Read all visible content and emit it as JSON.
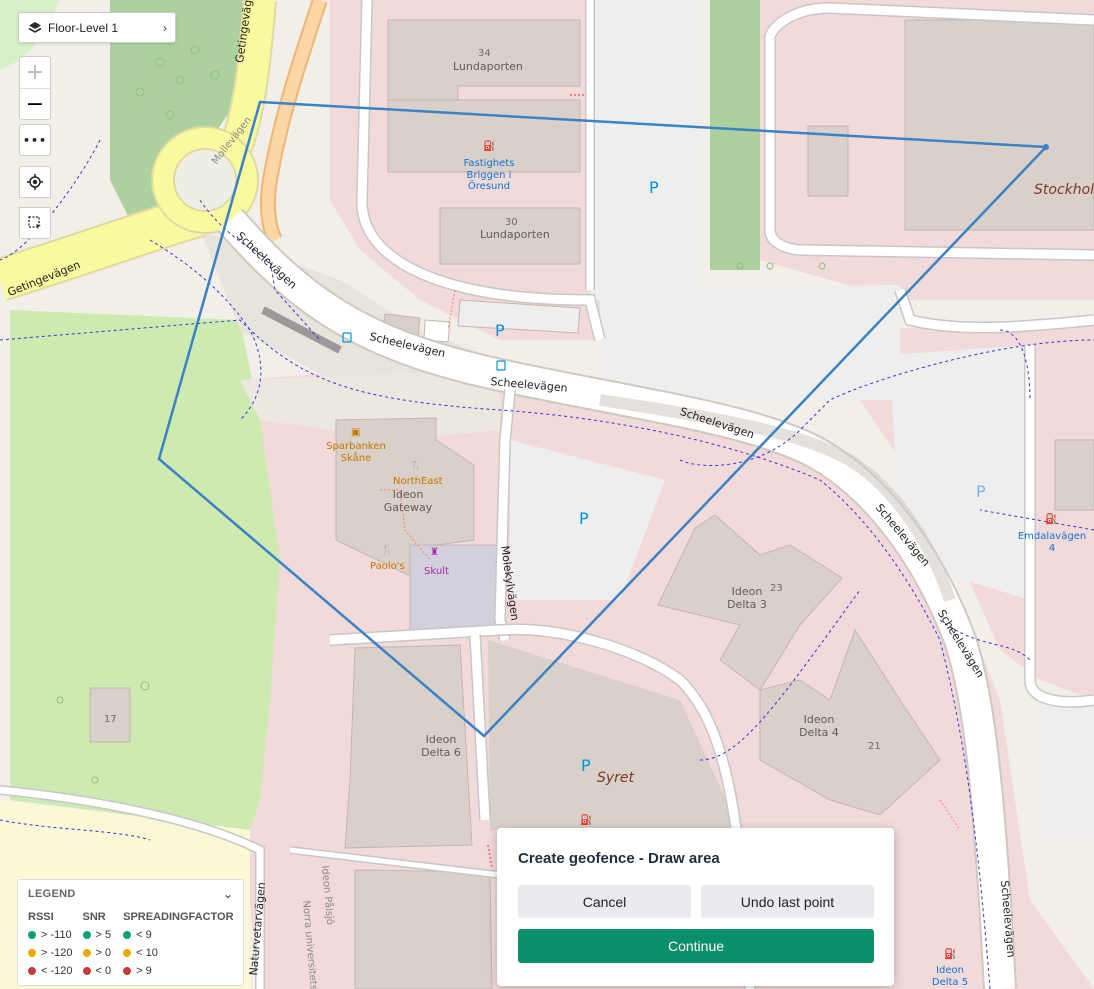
{
  "floor_selector": {
    "label": "Floor-Level 1",
    "icon": "layers-icon"
  },
  "map_controls": {
    "zoom_in": "+",
    "zoom_out": "−",
    "more": "•••",
    "locate_icon": "crosshair-icon",
    "select_icon": "area-select-icon"
  },
  "map": {
    "roads": [
      "Getingevägen",
      "Getingevägen",
      "Mollevägen",
      "Scheelevägen",
      "Scheelevägen",
      "Scheelevägen",
      "Scheelevägen",
      "Scheelevägen",
      "Scheelevägen",
      "Scheelevägen",
      "Molekylvägen",
      "Naturvetarvägen",
      "Ideon Pålsjö",
      "Norra universitetsområdet",
      "Scheelevägen"
    ],
    "buildings": [
      {
        "number": "34",
        "name": "Lundaporten"
      },
      {
        "number": "30",
        "name": "Lundaporten"
      },
      {
        "number": "23",
        "name": "Ideon Delta 3"
      },
      {
        "number": "21",
        "name": "Ideon Delta 4"
      },
      {
        "number": "",
        "name": "Ideon Delta 6"
      },
      {
        "number": "17",
        "name": ""
      },
      {
        "number": "",
        "name": "Ideon Gateway"
      }
    ],
    "pois": [
      {
        "name": "Fastighets Briggen i Öresund",
        "icon": "ev-charging-icon"
      },
      {
        "name": "Sparbanken Skåne",
        "icon": "bank-icon"
      },
      {
        "name": "NorthEast",
        "icon": "restaurant-icon"
      },
      {
        "name": "Paolo's",
        "icon": "restaurant-icon"
      },
      {
        "name": "Skult",
        "icon": "theatre-icon"
      },
      {
        "name": "Emdalavägen 4",
        "icon": "ev-charging-icon"
      },
      {
        "name": "Ideon Delta 5",
        "icon": "ev-charging-icon"
      }
    ],
    "places": [
      "Stockholm",
      "Syret"
    ],
    "parking": "P"
  },
  "legend": {
    "title": "LEGEND",
    "collapse_icon": "chevron-down-icon",
    "columns": [
      {
        "title": "RSSI",
        "rows": [
          {
            "color": "#0b9e78",
            "label": "> -110"
          },
          {
            "color": "#e6ac00",
            "label": "> -120"
          },
          {
            "color": "#c43c3c",
            "label": "< -120"
          }
        ]
      },
      {
        "title": "SNR",
        "rows": [
          {
            "color": "#0b9e78",
            "label": "> 5"
          },
          {
            "color": "#e6ac00",
            "label": "> 0"
          },
          {
            "color": "#c43c3c",
            "label": "< 0"
          }
        ]
      },
      {
        "title": "SPREADINGFACTOR",
        "rows": [
          {
            "color": "#0b9e78",
            "label": "< 9"
          },
          {
            "color": "#e6ac00",
            "label": "< 10"
          },
          {
            "color": "#c43c3c",
            "label": "> 9"
          }
        ]
      }
    ]
  },
  "dialog": {
    "title": "Create geofence - Draw area",
    "cancel": "Cancel",
    "undo": "Undo last point",
    "continue": "Continue"
  },
  "colors": {
    "geofence": "#3b82c4",
    "primary": "#0b8f6a",
    "residential": "#f2dada",
    "building": "#d9d0c9",
    "park": "#cdebb0",
    "parking": "#eeeeee",
    "motorway": "#f9f9a0"
  }
}
